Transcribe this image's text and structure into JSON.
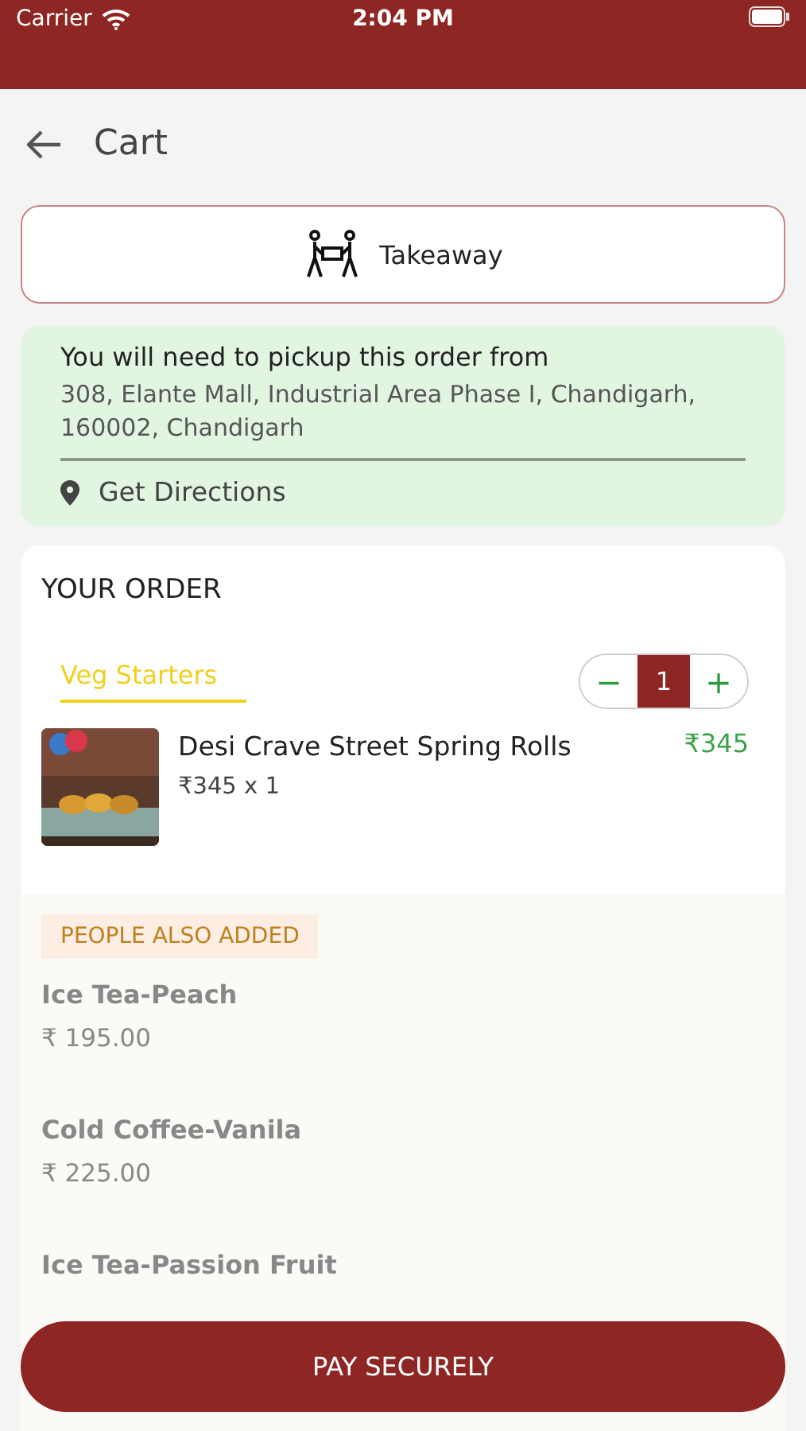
{
  "status_bar": {
    "carrier": "Carrier",
    "time": "2:04 PM"
  },
  "header": {
    "title": "Cart"
  },
  "order_type": {
    "label": "Takeaway",
    "selected": true
  },
  "pickup": {
    "heading": "You will need to pickup this order from",
    "address": "308, Elante Mall, Industrial Area Phase I, Chandigarh, 160002, Chandigarh",
    "directions": "Get Directions"
  },
  "order": {
    "title": "YOUR ORDER",
    "category": "Veg Starters",
    "quantity": {
      "minus": "−",
      "value": "1",
      "plus": "+"
    },
    "items": [
      {
        "name": "Desi Crave Street Spring Rolls",
        "unit_line": "₹345 x 1",
        "price": "₹345",
        "kind": "picture"
      }
    ]
  },
  "suggestions": {
    "title": "PEOPLE ALSO ADDED",
    "items": [
      {
        "name": "Ice Tea-Peach",
        "price": "₹ 195.00"
      },
      {
        "name": "Cold Coffee-Vanila",
        "price": "₹ 225.00"
      },
      {
        "name": "Ice Tea-Passion Fruit"
      }
    ]
  },
  "pay_button": {
    "label": "PAY SECURELY"
  }
}
